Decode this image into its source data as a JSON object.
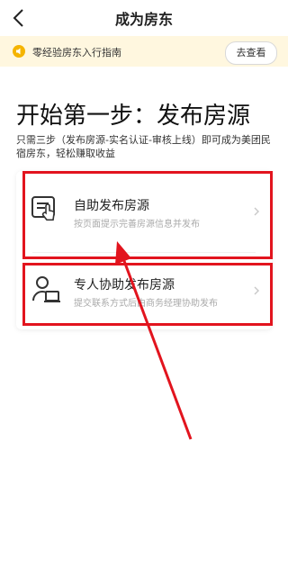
{
  "nav": {
    "title": "成为房东"
  },
  "notice": {
    "text": "零经验房东入行指南",
    "button_label": "去查看"
  },
  "intro": {
    "headline": "开始第一步：发布房源",
    "subtext": "只需三步（发布房源-实名认证-审核上线）即可成为美团民宿房东，轻松赚取收益"
  },
  "options": [
    {
      "title": "自助发布房源",
      "desc": "按页面提示完善房源信息并发布",
      "icon": "self-publish-icon"
    },
    {
      "title": "专人协助发布房源",
      "desc": "提交联系方式后由商务经理协助发布",
      "icon": "assisted-publish-icon"
    }
  ],
  "colors": {
    "annotation": "#e2141e",
    "notice_bg": "#fff7df",
    "accent": "#f5b400"
  }
}
